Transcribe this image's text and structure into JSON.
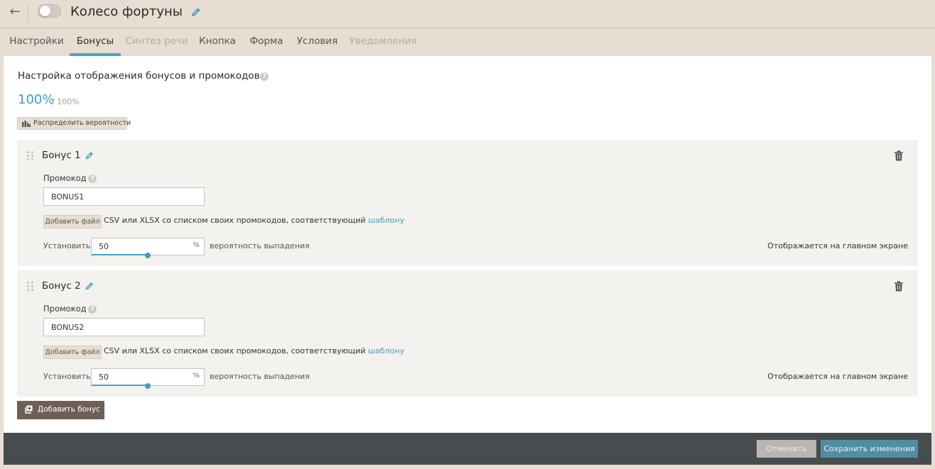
{
  "header": {
    "back_label": "←",
    "title": "Колесо фортуны",
    "toggle_enabled": false
  },
  "tabs": [
    {
      "label": "Настройки",
      "state": "normal"
    },
    {
      "label": "Бонусы",
      "state": "active"
    },
    {
      "label": "Синтез речи",
      "state": "disabled"
    },
    {
      "label": "Кнопка",
      "state": "normal"
    },
    {
      "label": "Форма",
      "state": "normal"
    },
    {
      "label": "Условия",
      "state": "normal"
    },
    {
      "label": "Уведомления",
      "state": "disabled"
    }
  ],
  "main": {
    "section_title": "Настройка отображения бонусов и промокодов",
    "help_glyph": "?",
    "percent_value": "100%",
    "percent_total": "/ 100%",
    "distribute_label": "Распределить вероятности",
    "bonuses": [
      {
        "name": "Бонус 1",
        "promo_label": "Промокод",
        "promo_value": "BONUS1",
        "file_button": "Добавить файл",
        "file_text": "CSV или XLSX со списком своих промокодов, соответствующий",
        "file_link": "шаблону",
        "set_label": "Установить",
        "probability": "50",
        "probability_fraction": 0.5,
        "unit": "%",
        "probability_suffix": "вероятность выпадения",
        "display_status": "Отображается на главном экране"
      },
      {
        "name": "Бонус 2",
        "promo_label": "Промокод",
        "promo_value": "BONUS2",
        "file_button": "Добавить файл",
        "file_text": "CSV или XLSX со списком своих промокодов, соответствующий",
        "file_link": "шаблону",
        "set_label": "Установить",
        "probability": "50",
        "probability_fraction": 0.5,
        "unit": "%",
        "probability_suffix": "вероятность выпадения",
        "display_status": "Отображается на главном экране"
      }
    ],
    "add_bonus_label": "Добавить бонус"
  },
  "footer": {
    "cancel_label": "Отменить",
    "save_label": "Сохранить изменения"
  },
  "colors": {
    "accent": "#46a3c4",
    "background": "#e7ddd2",
    "footer": "#454d4f",
    "primary_button": "#4f8ea3",
    "add_button": "#6e6056"
  },
  "icons": {
    "back": "arrow-left-icon",
    "edit": "pencil-icon",
    "help": "question-circle-icon",
    "distribute": "bar-chart-icon",
    "drag": "drag-handle-icon",
    "delete": "trash-icon",
    "add": "add-square-icon"
  }
}
